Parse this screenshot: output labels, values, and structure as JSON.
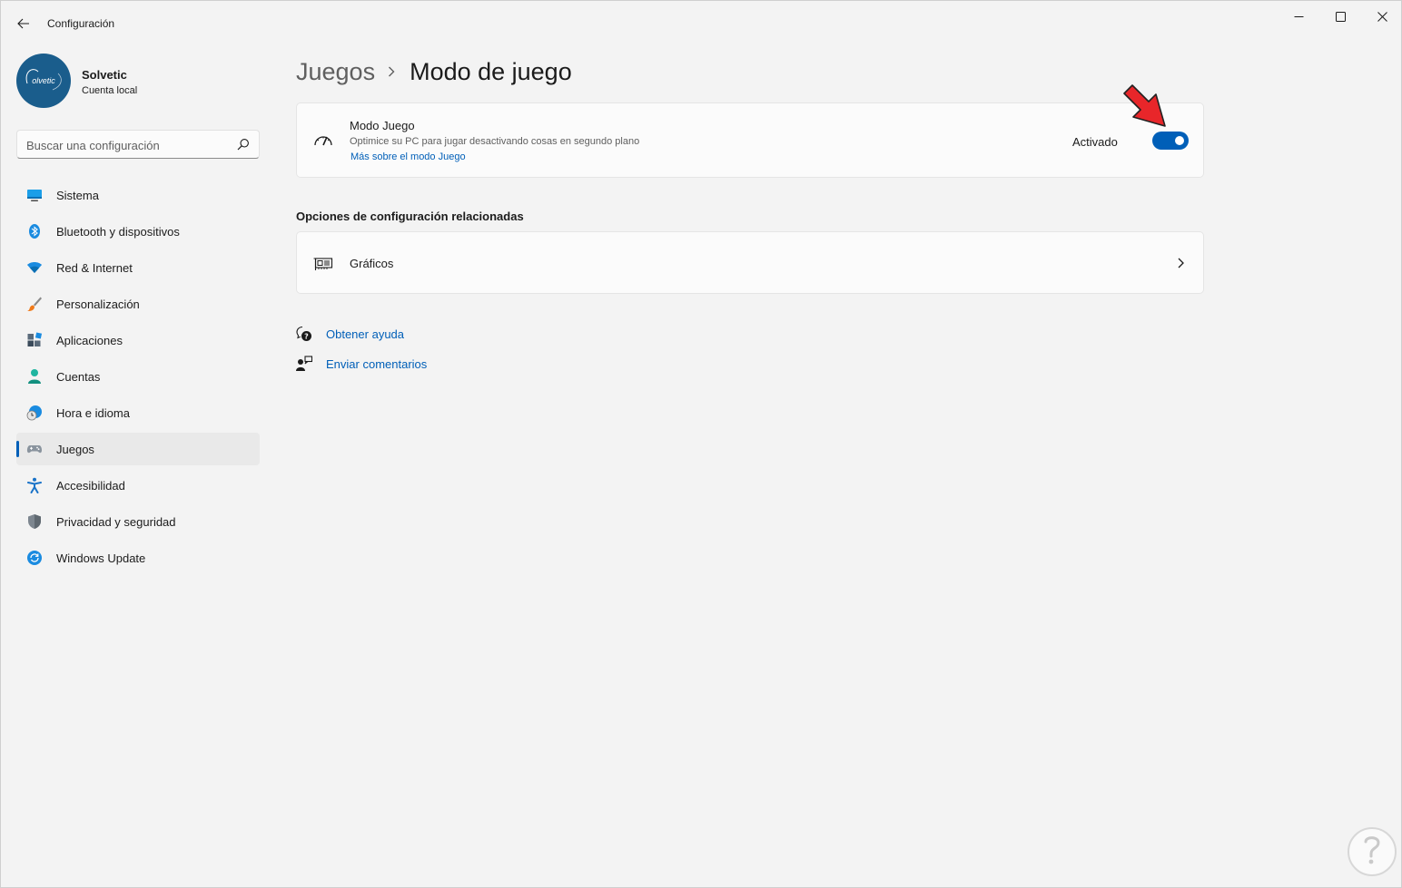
{
  "window": {
    "title": "Configuración",
    "controls": [
      "minimize",
      "maximize",
      "close"
    ]
  },
  "profile": {
    "avatar_text": "olvetic",
    "name": "Solvetic",
    "account_type": "Cuenta local"
  },
  "search": {
    "placeholder": "Buscar una configuración",
    "value": ""
  },
  "sidebar": {
    "items": [
      {
        "label": "Sistema",
        "icon": "monitor-icon",
        "active": false
      },
      {
        "label": "Bluetooth y dispositivos",
        "icon": "bluetooth-icon",
        "active": false
      },
      {
        "label": "Red & Internet",
        "icon": "wifi-icon",
        "active": false
      },
      {
        "label": "Personalización",
        "icon": "paintbrush-icon",
        "active": false
      },
      {
        "label": "Aplicaciones",
        "icon": "apps-icon",
        "active": false
      },
      {
        "label": "Cuentas",
        "icon": "person-icon",
        "active": false
      },
      {
        "label": "Hora e idioma",
        "icon": "clock-globe-icon",
        "active": false
      },
      {
        "label": "Juegos",
        "icon": "gamepad-icon",
        "active": true
      },
      {
        "label": "Accesibilidad",
        "icon": "accessibility-icon",
        "active": false
      },
      {
        "label": "Privacidad y seguridad",
        "icon": "shield-icon",
        "active": false
      },
      {
        "label": "Windows Update",
        "icon": "update-icon",
        "active": false
      }
    ]
  },
  "breadcrumb": {
    "parent": "Juegos",
    "current": "Modo de juego"
  },
  "game_mode": {
    "title": "Modo Juego",
    "description": "Optimice su PC para jugar desactivando cosas en segundo plano",
    "link": "Más sobre el modo Juego",
    "state_label": "Activado",
    "enabled": true
  },
  "related": {
    "title": "Opciones de configuración relacionadas",
    "graphics_label": "Gráficos"
  },
  "help": {
    "get_help": "Obtener ayuda",
    "feedback": "Enviar comentarios"
  },
  "colors": {
    "accent": "#005fb8",
    "background": "#f3f3f3",
    "card": "#fbfbfb",
    "annotation_arrow": "#e8262a"
  }
}
